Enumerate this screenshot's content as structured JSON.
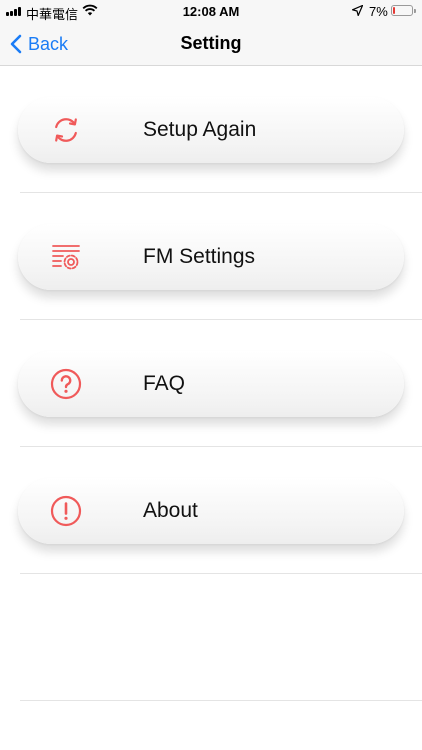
{
  "status_bar": {
    "carrier": "中華電信",
    "time": "12:08 AM",
    "battery_percent": "7%",
    "battery_level": 0.07,
    "battery_color": "#e53935"
  },
  "nav": {
    "back_label": "Back",
    "title": "Setting",
    "accent": "#1a7cf6"
  },
  "menu": {
    "icon_color": "#f05a5a",
    "items": [
      {
        "label": "Setup Again",
        "icon": "refresh-icon"
      },
      {
        "label": "FM Settings",
        "icon": "list-gear-icon"
      },
      {
        "label": "FAQ",
        "icon": "question-circle-icon"
      },
      {
        "label": "About",
        "icon": "exclamation-circle-icon"
      }
    ]
  }
}
